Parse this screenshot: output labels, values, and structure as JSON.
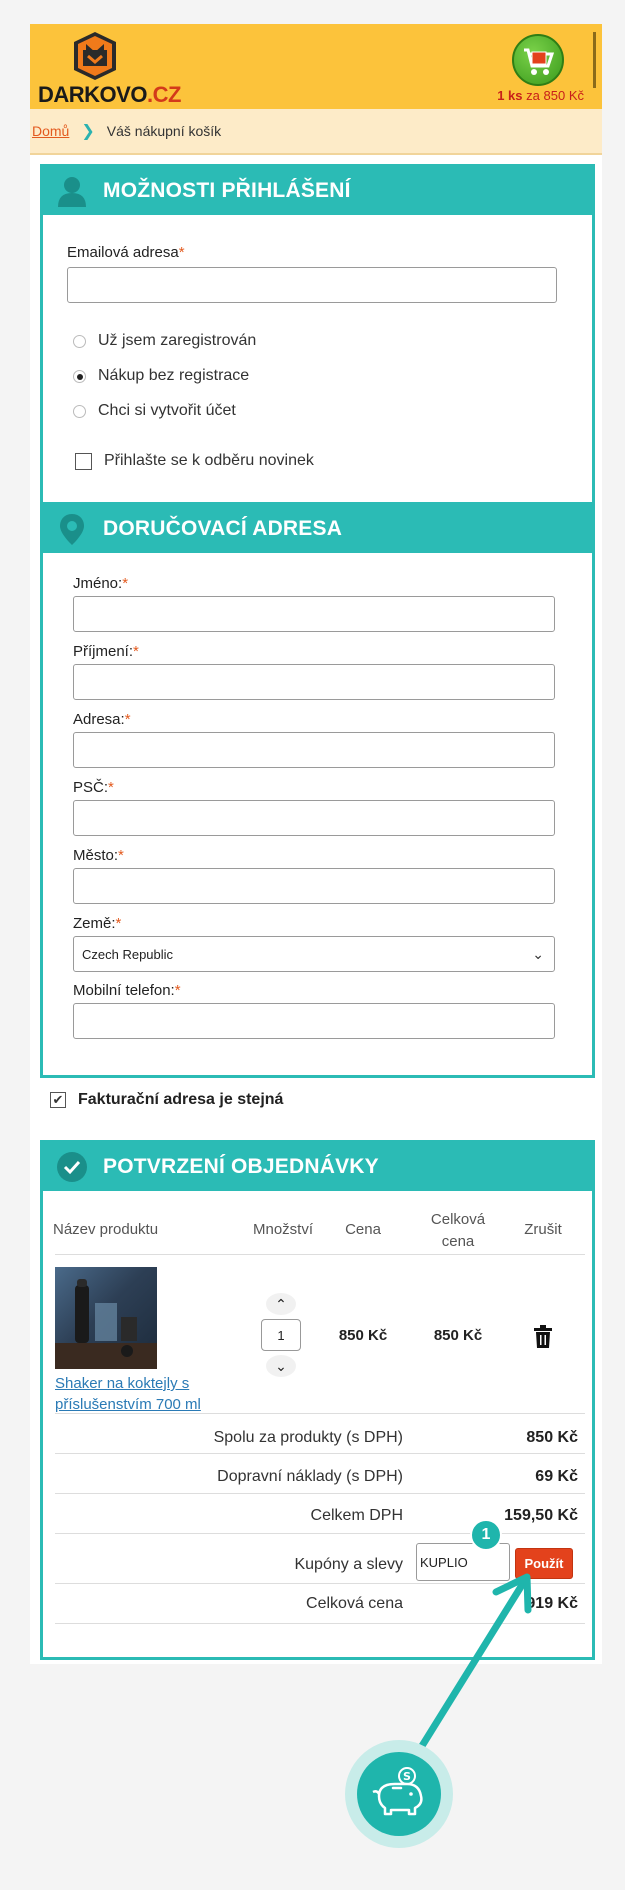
{
  "header": {
    "logo_text_main": "DARKOVO",
    "logo_text_tld": ".CZ",
    "cart_qty": "1 ks",
    "cart_za": "za",
    "cart_price": "850 Kč"
  },
  "breadcrumb": {
    "home": "Domů",
    "current": "Váš nákupní košík"
  },
  "login": {
    "title": "MOŽNOSTI PŘIHLÁŠENÍ",
    "email_label": "Emailová adresa",
    "email_value": "",
    "options": [
      {
        "label": "Už jsem zaregistrován",
        "checked": false
      },
      {
        "label": "Nákup bez registrace",
        "checked": true
      },
      {
        "label": "Chci si vytvořit účet",
        "checked": false
      }
    ],
    "newsletter_label": "Přihlašte se k odběru novinek",
    "newsletter_checked": false
  },
  "delivery": {
    "title": "DORUČOVACÍ ADRESA",
    "fields": [
      {
        "label": "Jméno:",
        "value": ""
      },
      {
        "label": "Příjmení:",
        "value": ""
      },
      {
        "label": "Adresa:",
        "value": ""
      },
      {
        "label": "PSČ:",
        "value": ""
      },
      {
        "label": "Město:",
        "value": ""
      }
    ],
    "country_label": "Země:",
    "country_value": "Czech Republic",
    "phone_label": "Mobilní telefon:",
    "phone_value": ""
  },
  "billing_same": {
    "label": "Fakturační adresa je stejná",
    "checked": true
  },
  "order": {
    "title": "POTVRZENÍ OBJEDNÁVKY",
    "columns": {
      "name": "Název produktu",
      "qty": "Množství",
      "price": "Cena",
      "total_line1": "Celková",
      "total_line2": "cena",
      "remove": "Zrušit"
    },
    "item": {
      "name_line1": "Shaker na koktejly s",
      "name_line2": "příslušenstvím 700 ml",
      "qty": "1",
      "price": "850 Kč",
      "total": "850 Kč"
    },
    "summary": {
      "products_label": "Spolu za produkty (s DPH)",
      "products_value": "850 Kč",
      "shipping_label": "Dopravní náklady (s DPH)",
      "shipping_value": "69 Kč",
      "vat_label": "Celkem DPH",
      "vat_value": "159,50 Kč",
      "coupon_label": "Kupóny a slevy",
      "coupon_value": "KUPLIO",
      "apply_label": "Použít",
      "total_label": "Celková cena",
      "total_value": "919 Kč"
    }
  },
  "overlay": {
    "step_badge": "1",
    "accent": "#1fb5ac"
  },
  "colors": {
    "header_bg": "#fcc33b",
    "section_teal": "#2bbbb5",
    "required": "#e35a1e",
    "apply_button": "#e3421c"
  }
}
